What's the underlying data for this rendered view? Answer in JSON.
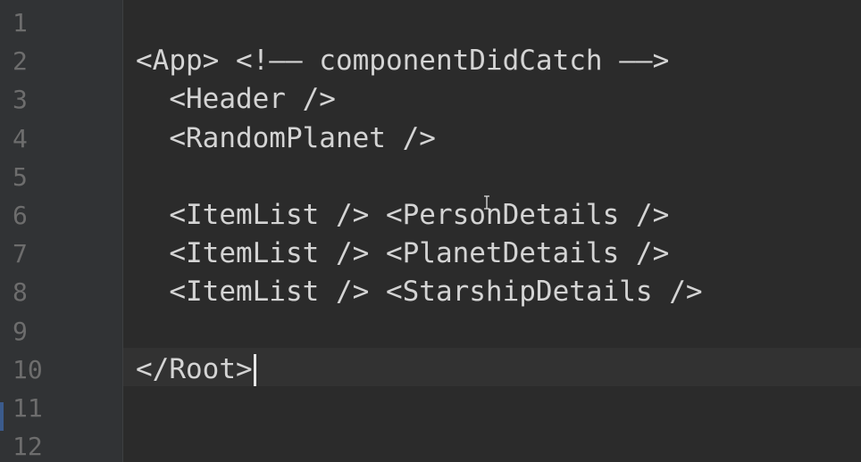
{
  "editor": {
    "line_numbers": [
      "1",
      "2",
      "3",
      "4",
      "5",
      "6",
      "7",
      "8",
      "9",
      "10",
      "11",
      "12"
    ],
    "lines": [
      "",
      "<App> <!—— componentDidCatch ——>",
      "  <Header />",
      "  <RandomPlanet />",
      "",
      "  <ItemList /> <PersonDetails />",
      "  <ItemList /> <PlanetDetails />",
      "  <ItemList /> <StarshipDetails />",
      "",
      "</Root>",
      "",
      ""
    ],
    "current_line": 10
  },
  "colors": {
    "background": "#2b2b2b",
    "gutter": "#313335",
    "line_number": "#6d6d6d",
    "text": "#d4d4d4",
    "current_line": "#323232"
  },
  "icons": {
    "cursor": "ibeam-icon"
  }
}
